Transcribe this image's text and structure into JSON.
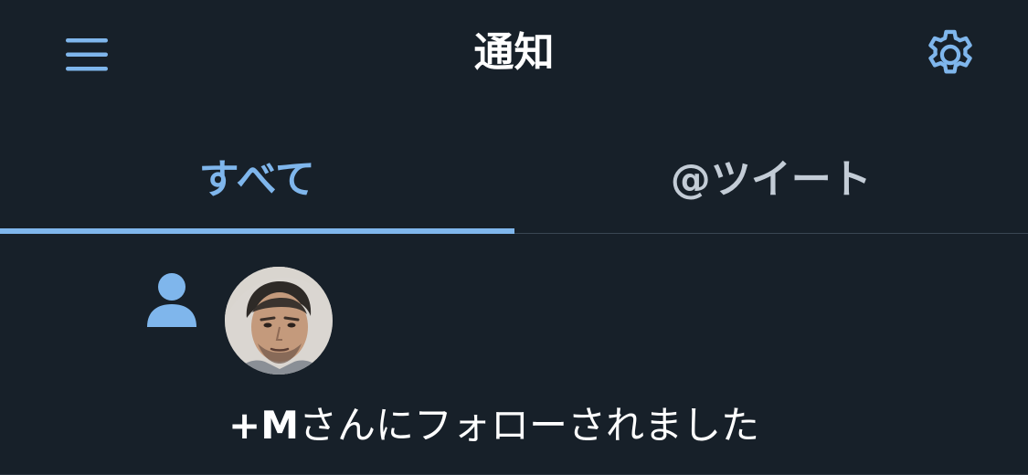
{
  "header": {
    "title": "通知",
    "menu_icon": "hamburger-menu-icon",
    "settings_icon": "gear-icon"
  },
  "tabs": [
    {
      "label": "すべて",
      "active": true
    },
    {
      "label": "@ツイート",
      "active": false
    }
  ],
  "notification": {
    "type_icon": "person-follow-icon",
    "follower_name": "+M",
    "message": "さんにフォローされました"
  },
  "colors": {
    "background": "#172029",
    "accent": "#7fb6ec",
    "text_primary": "#ffffff",
    "text_secondary": "#c3ccd6",
    "divider": "#3a4653"
  }
}
